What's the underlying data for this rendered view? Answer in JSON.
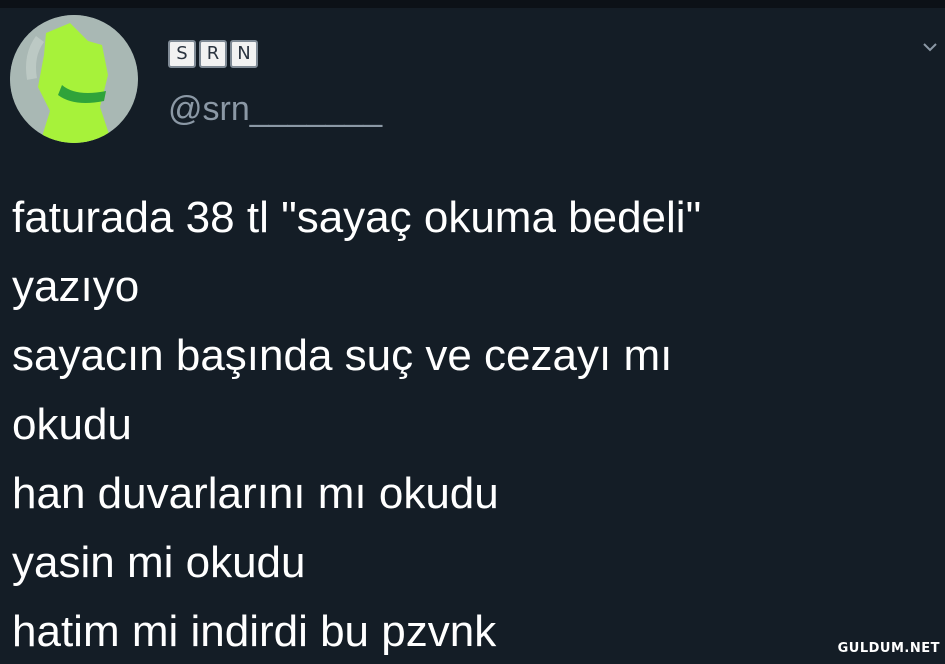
{
  "profile": {
    "name_badges": [
      "S",
      "R",
      "N"
    ],
    "handle": "@srn_______"
  },
  "tweet": {
    "lines": [
      "faturada 38 tl \"sayaç okuma bedeli\"",
      "yazıyo",
      "sayacın başında suç ve cezayı mı",
      "okudu",
      "han duvarlarını mı okudu",
      "yasin mi okudu",
      "hatim mi indirdi bu pzvnk"
    ]
  },
  "icons": {
    "menu": "chevron-down-icon",
    "avatar": "avatar-image"
  },
  "colors": {
    "background": "#141d26",
    "text": "#ffffff",
    "secondary_text": "#8b98a5"
  },
  "watermark": "GULDUM.NET"
}
